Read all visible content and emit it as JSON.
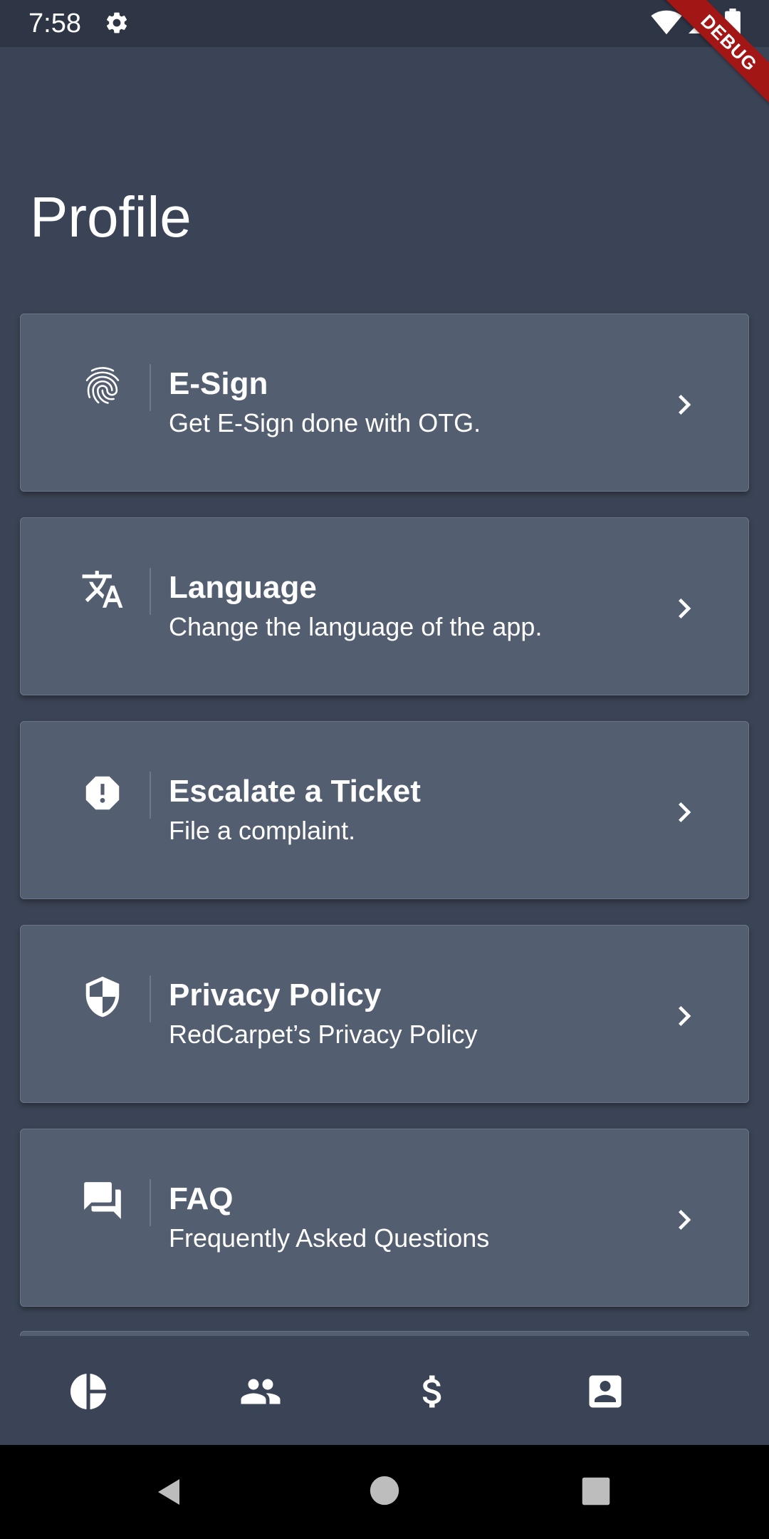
{
  "status_bar": {
    "time": "7:58",
    "icons": [
      "gear-icon",
      "wifi-icon",
      "signal-icon",
      "battery-icon"
    ],
    "debug_label": "DEBUG"
  },
  "page": {
    "title": "Profile"
  },
  "menu": {
    "items": [
      {
        "icon": "fingerprint-icon",
        "title": "E-Sign",
        "subtitle": "Get E-Sign done with OTG."
      },
      {
        "icon": "translate-icon",
        "title": "Language",
        "subtitle": "Change the language of the app."
      },
      {
        "icon": "report-icon",
        "title": "Escalate a Ticket",
        "subtitle": "File a complaint."
      },
      {
        "icon": "shield-icon",
        "title": "Privacy Policy",
        "subtitle": "RedCarpet’s Privacy Policy"
      },
      {
        "icon": "forum-icon",
        "title": "FAQ",
        "subtitle": "Frequently Asked Questions"
      }
    ]
  },
  "bottom_nav": {
    "items": [
      "pie-chart-icon",
      "people-icon",
      "dollar-icon",
      "account-box-icon"
    ],
    "selected": "account-box-icon"
  },
  "system_nav": {
    "items": [
      "back-icon",
      "home-icon",
      "recents-icon"
    ]
  },
  "colors": {
    "background": "#3B4456",
    "status_bar": "#2E3544",
    "card": "#535E70",
    "debug_banner": "#A21616",
    "text": "#FFFFFF"
  }
}
